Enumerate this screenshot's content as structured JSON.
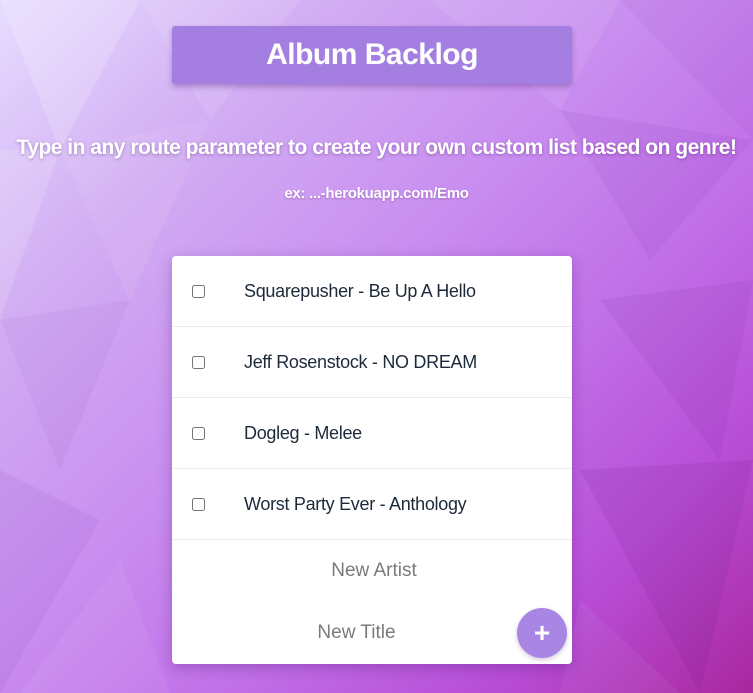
{
  "header": {
    "title": "Album Backlog"
  },
  "intro": {
    "subtitle": "Type in any route parameter to create your own custom list based on genre!",
    "example": "ex: ...-herokuapp.com/Emo"
  },
  "albums": [
    {
      "label": "Squarepusher - Be Up A Hello",
      "checked": false
    },
    {
      "label": "Jeff Rosenstock - NO DREAM",
      "checked": false
    },
    {
      "label": "Dogleg - Melee",
      "checked": false
    },
    {
      "label": "Worst Party Ever - Anthology",
      "checked": false
    }
  ],
  "form": {
    "artist_placeholder": "New Artist",
    "title_placeholder": "New Title",
    "add_icon": "plus-icon",
    "add_symbol": "+"
  },
  "colors": {
    "accent": "#a47fe1",
    "button": "#a986e4",
    "text": "#1d2a3a"
  }
}
